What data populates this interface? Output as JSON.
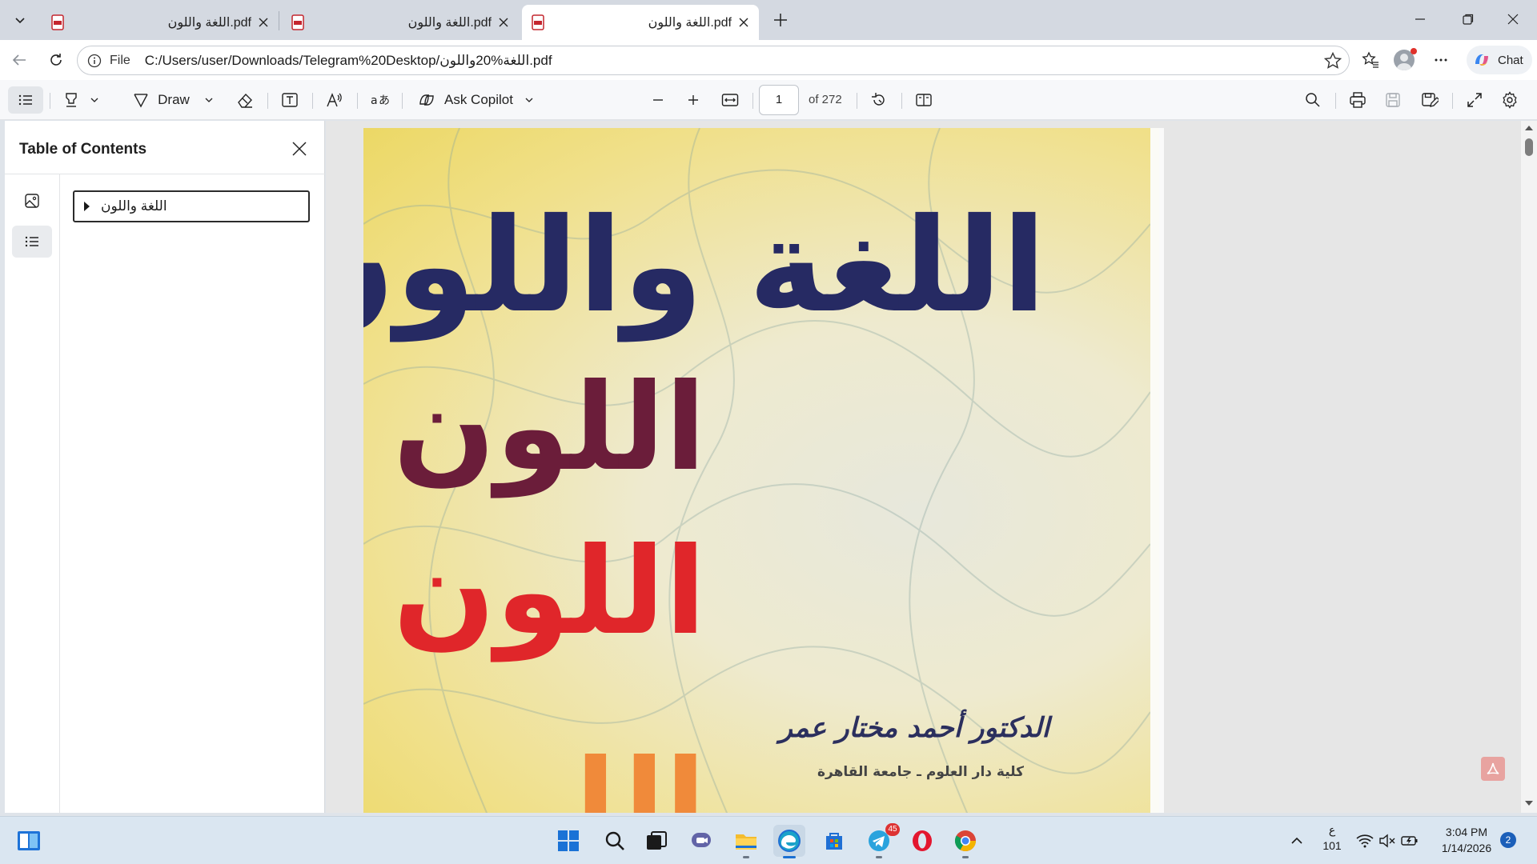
{
  "browser": {
    "tabs": [
      {
        "title": "اللغة واللون.pdf",
        "favicon": "pdf-icon",
        "active": false
      },
      {
        "title": "اللغة واللون.pdf",
        "favicon": "pdf-icon",
        "active": false
      },
      {
        "title": "اللغة واللون.pdf",
        "favicon": "pdf-icon",
        "active": true
      }
    ],
    "address": {
      "scheme": "File",
      "url": "C:/Users/user/Downloads/Telegram%20Desktop/اللغة%20واللون.pdf"
    },
    "chat_label": "Chat"
  },
  "pdf_toolbar": {
    "draw_label": "Draw",
    "ask_copilot_label": "Ask Copilot",
    "page_current": "1",
    "page_total_label": "of 272"
  },
  "sidebar": {
    "title": "Table of Contents",
    "toc": [
      {
        "label": "اللغة واللون",
        "expanded": false
      }
    ]
  },
  "document": {
    "cover": {
      "line1": "اللغة واللون",
      "line2": "اللون",
      "line3": "اللون",
      "line4": "الل",
      "author": "الدكتور أحمد مختار عمر",
      "affiliation": "كلية دار العلوم ـ جامعة القاهرة"
    },
    "colors": {
      "title_navy": "#262a63",
      "title_maroon": "#6b1d3a",
      "title_red": "#e0262a",
      "cover_yellow": "#eeda6a"
    }
  },
  "taskbar": {
    "apps": [
      "windows-start-icon",
      "search-icon",
      "task-view-icon",
      "teams-icon",
      "file-explorer-icon",
      "edge-icon",
      "microsoft-store-icon",
      "telegram-icon",
      "opera-icon",
      "chrome-icon"
    ],
    "telegram_badge": "45",
    "tray": {
      "language_top": "ع",
      "language_bottom": "101",
      "time": "3:04 PM",
      "date": "1/14/2026",
      "notification_count": "2"
    }
  }
}
